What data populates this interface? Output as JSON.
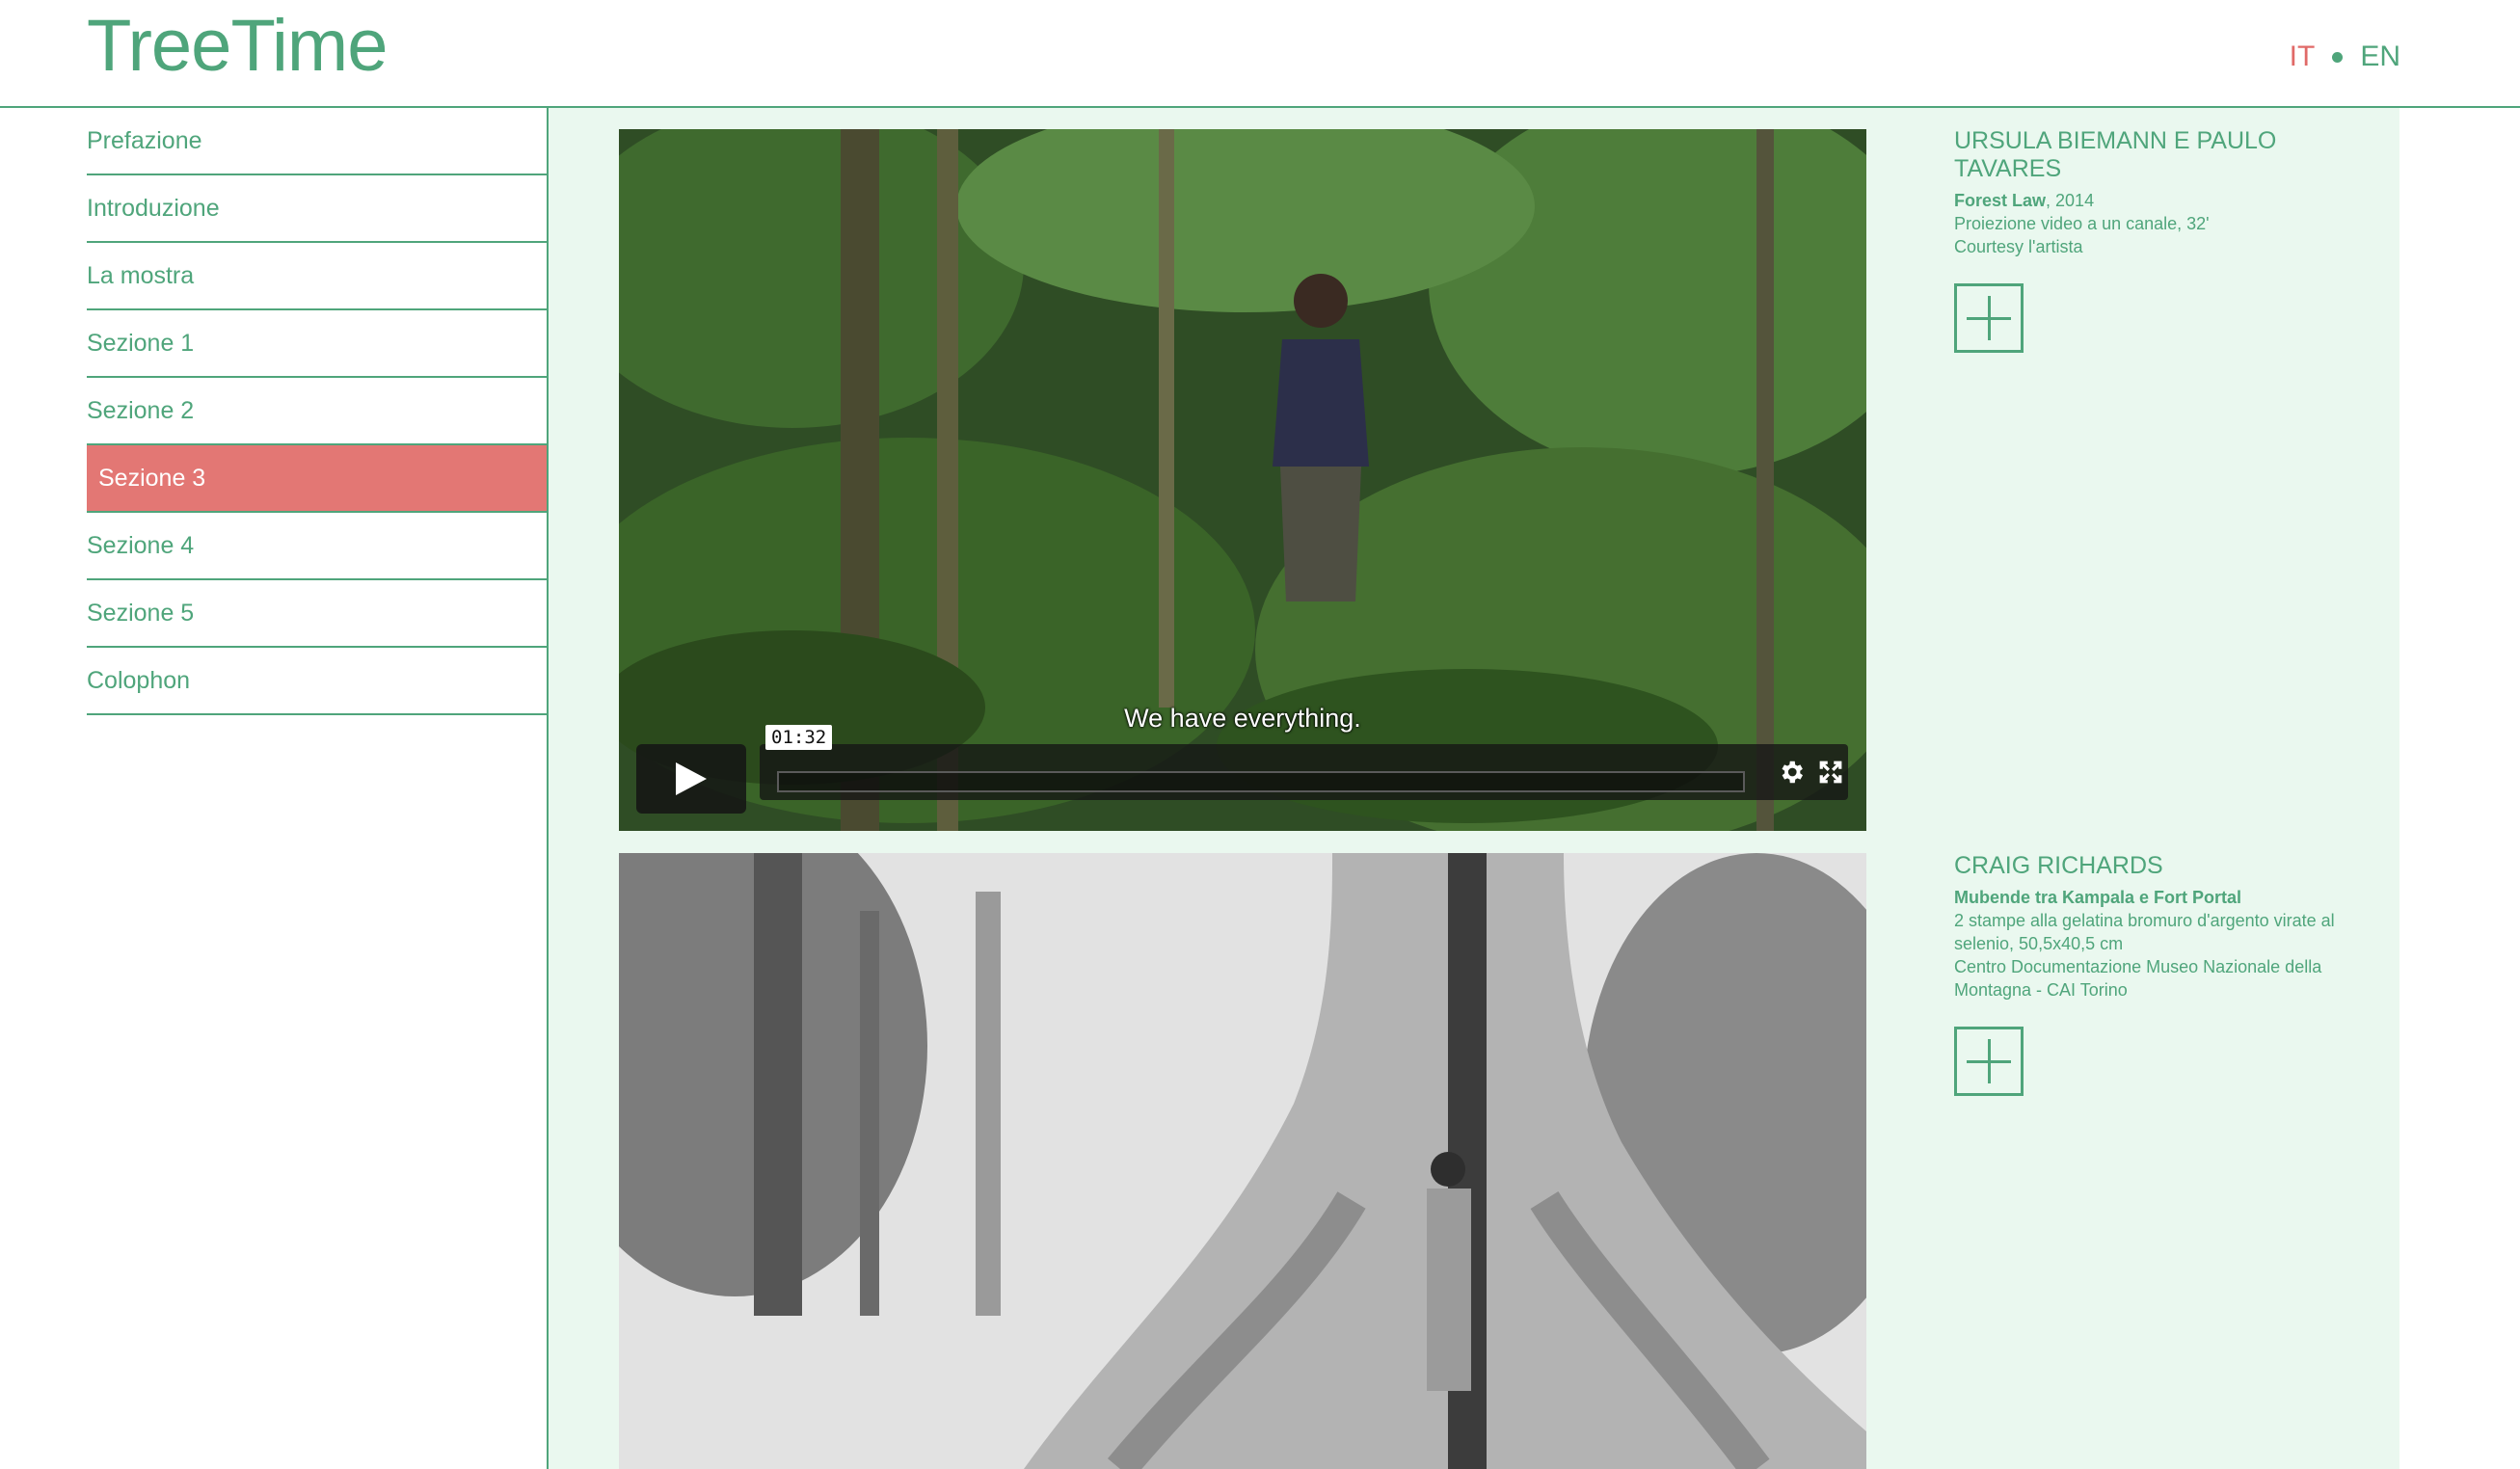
{
  "header": {
    "logo": "TreeTime",
    "lang_it": "IT",
    "lang_en": "EN"
  },
  "sidebar": {
    "items": [
      {
        "label": "Prefazione"
      },
      {
        "label": "Introduzione"
      },
      {
        "label": "La mostra"
      },
      {
        "label": "Sezione 1"
      },
      {
        "label": "Sezione 2"
      },
      {
        "label": "Sezione 3",
        "active": true
      },
      {
        "label": "Sezione 4"
      },
      {
        "label": "Sezione 5"
      },
      {
        "label": "Colophon"
      }
    ]
  },
  "video": {
    "subtitle": "We have everything.",
    "timecode": "01:32",
    "progress": 0.0
  },
  "works": [
    {
      "artist": "URSULA BIEMANN E PAULO TAVARES",
      "title": "Forest Law",
      "year": ", 2014",
      "medium": "Proiezione video a un canale, 32'",
      "credit": "Courtesy l'artista"
    },
    {
      "artist": "CRAIG RICHARDS",
      "title": "Mubende tra Kampala e Fort Portal",
      "medium": "2 stampe alla gelatina bromuro d'argento virate al selenio, 50,5x40,5 cm",
      "credit": "Centro Documentazione Museo Nazionale della Montagna - CAI Torino"
    }
  ],
  "colors": {
    "accent": "#4fa57b",
    "active": "#e37774",
    "panel": "#eaf8ef"
  }
}
